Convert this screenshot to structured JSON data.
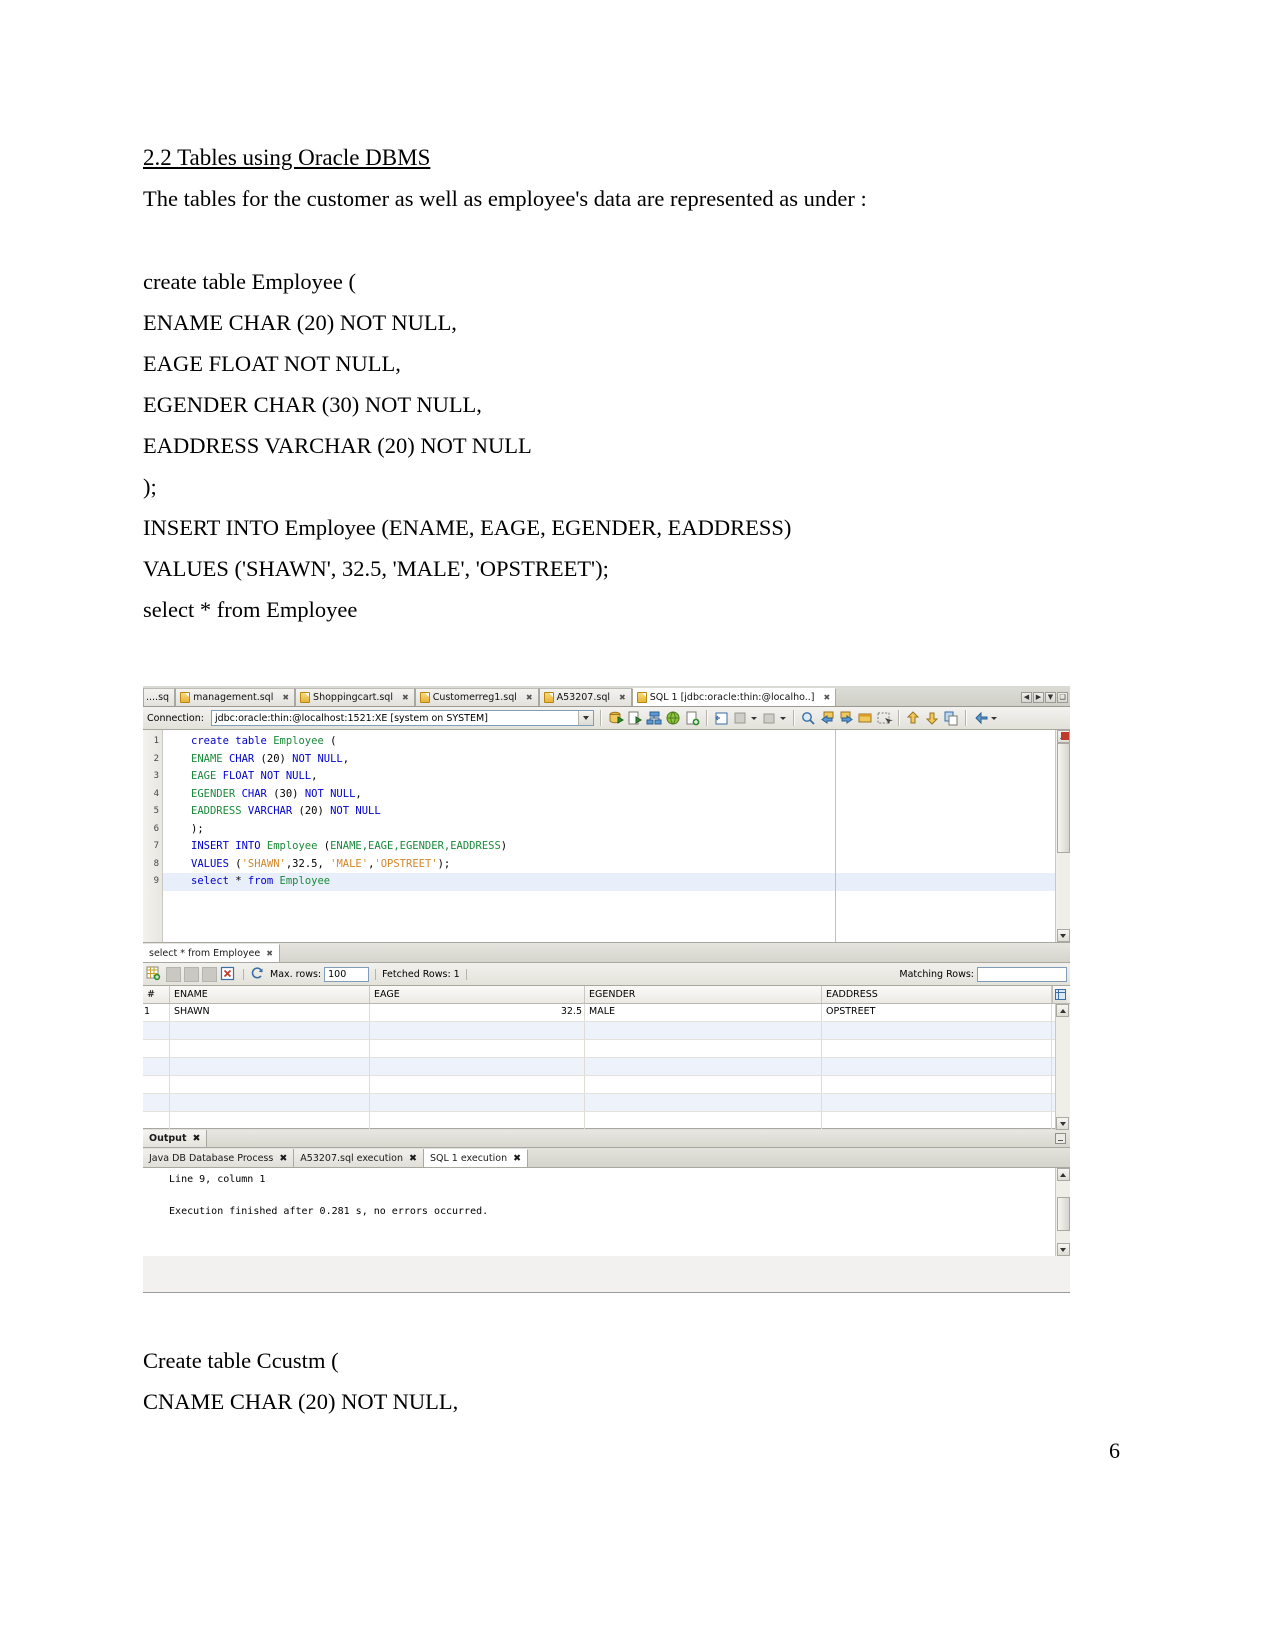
{
  "document": {
    "heading": "2.2 Tables using Oracle DBMS",
    "intro": "The tables for the customer as well as employee's data are represented as under :",
    "sql_lines": [
      "create table Employee (",
      "ENAME CHAR (20) NOT NULL,",
      "EAGE FLOAT NOT NULL,",
      "EGENDER CHAR (30) NOT NULL,",
      "EADDRESS VARCHAR (20) NOT NULL",
      ");",
      "INSERT INTO Employee (ENAME, EAGE, EGENDER, EADDRESS)",
      "VALUES ('SHAWN', 32.5, 'MALE', 'OPSTREET');",
      "select * from Employee"
    ],
    "bottom_lines": [
      "Create table Ccustm (",
      "CNAME CHAR (20) NOT NULL,"
    ],
    "page_number": "6"
  },
  "ide": {
    "tabs": [
      {
        "label": "....sq",
        "truncated": true,
        "icon": "sql-file-icon",
        "active": false,
        "closable": false
      },
      {
        "label": "management.sql",
        "icon": "sql-file-icon",
        "active": false,
        "closable": true
      },
      {
        "label": "Shoppingcart.sql",
        "icon": "sql-file-icon",
        "active": false,
        "closable": true
      },
      {
        "label": "Customerreg1.sql",
        "icon": "sql-file-icon",
        "active": false,
        "closable": true
      },
      {
        "label": "A53207.sql",
        "icon": "sql-file-icon",
        "active": false,
        "closable": true
      },
      {
        "label": "SQL 1 [jdbc:oracle:thin:@localho..]",
        "icon": "sql-file-icon",
        "active": true,
        "closable": true
      }
    ],
    "tab_close_glyph": "✖",
    "tab_nav_buttons": [
      "◀",
      "▶",
      "▼",
      "❑"
    ],
    "connection": {
      "label": "Connection:",
      "value": "jdbc:oracle:thin:@localhost:1521:XE [system on SYSTEM]",
      "dropdown_icon": "chevron-down-icon"
    },
    "toolbar_icons": [
      "run-statement-icon",
      "run-script-icon",
      "explain-plan-icon",
      "globe-icon",
      "new-worksheet-icon",
      "commit-icon",
      "rollback-icon",
      "autocommit-icon",
      "find-icon",
      "previous-icon",
      "next-icon",
      "window-icon",
      "select-region-icon",
      "up-arrow-icon",
      "down-arrow-icon",
      "copy-icon",
      "history-icon",
      "overflow-chevron-icon"
    ],
    "editor": {
      "line_numbers": [
        "1",
        "2",
        "3",
        "4",
        "5",
        "6",
        "7",
        "8",
        "9"
      ],
      "lines": [
        [
          {
            "t": "create table ",
            "c": "kw"
          },
          {
            "t": "Employee",
            "c": "ident"
          },
          {
            "t": " (",
            "c": "punc"
          }
        ],
        [
          {
            "t": "ENAME",
            "c": "ident"
          },
          {
            "t": " ",
            "c": "punc"
          },
          {
            "t": "CHAR",
            "c": "kw"
          },
          {
            "t": " (20) ",
            "c": "punc"
          },
          {
            "t": "NOT NULL",
            "c": "kw"
          },
          {
            "t": ",",
            "c": "punc"
          }
        ],
        [
          {
            "t": "EAGE",
            "c": "ident"
          },
          {
            "t": " ",
            "c": "punc"
          },
          {
            "t": "FLOAT NOT NULL",
            "c": "kw"
          },
          {
            "t": ",",
            "c": "punc"
          }
        ],
        [
          {
            "t": "EGENDER",
            "c": "ident"
          },
          {
            "t": " ",
            "c": "punc"
          },
          {
            "t": "CHAR",
            "c": "kw"
          },
          {
            "t": " (30) ",
            "c": "punc"
          },
          {
            "t": "NOT NULL",
            "c": "kw"
          },
          {
            "t": ",",
            "c": "punc"
          }
        ],
        [
          {
            "t": "EADDRESS",
            "c": "ident"
          },
          {
            "t": " ",
            "c": "punc"
          },
          {
            "t": "VARCHAR",
            "c": "kw"
          },
          {
            "t": " (20) ",
            "c": "punc"
          },
          {
            "t": "NOT NULL",
            "c": "kw"
          }
        ],
        [
          {
            "t": ");",
            "c": "punc"
          }
        ],
        [
          {
            "t": "INSERT INTO",
            "c": "kw"
          },
          {
            "t": " ",
            "c": "punc"
          },
          {
            "t": "Employee",
            "c": "ident"
          },
          {
            "t": " (",
            "c": "punc"
          },
          {
            "t": "ENAME,EAGE,EGENDER,EADDRESS",
            "c": "ident"
          },
          {
            "t": ")",
            "c": "punc"
          }
        ],
        [
          {
            "t": "VALUES",
            "c": "kw"
          },
          {
            "t": " (",
            "c": "punc"
          },
          {
            "t": "'SHAWN'",
            "c": "str"
          },
          {
            "t": ",32.5, ",
            "c": "punc"
          },
          {
            "t": "'MALE'",
            "c": "str"
          },
          {
            "t": ",",
            "c": "punc"
          },
          {
            "t": "'OPSTREET'",
            "c": "str"
          },
          {
            "t": ");",
            "c": "punc"
          }
        ],
        [
          {
            "t": "select",
            "c": "kw"
          },
          {
            "t": " * ",
            "c": "punc"
          },
          {
            "t": "from",
            "c": "kw"
          },
          {
            "t": " ",
            "c": "punc"
          },
          {
            "t": "Employee",
            "c": "ident"
          }
        ]
      ],
      "current_line_index": 8
    },
    "result_tab": {
      "label": "select * from Employee",
      "close_glyph": "✖"
    },
    "result_toolbar": {
      "buttons": [
        "grid-export-icon",
        "grid-insert-icon",
        "grid-delete-icon",
        "grid-commit-icon",
        "grid-cancel-icon"
      ],
      "refresh_icon": "refresh-icon",
      "max_rows_label": "Max. rows:",
      "max_rows_value": "100",
      "fetched_rows_label": "Fetched Rows:",
      "fetched_rows_value": "1",
      "matching_rows_label": "Matching Rows:",
      "matching_rows_value": ""
    },
    "result_grid": {
      "columns": [
        "#",
        "ENAME",
        "EAGE",
        "EGENDER",
        "EADDRESS"
      ],
      "rows": [
        [
          "1",
          "SHAWN",
          "32.5",
          "MALE",
          "OPSTREET"
        ]
      ],
      "empty_row_count": 6
    },
    "output": {
      "panel_title": "Output",
      "panel_close_glyph": "✖",
      "tabs": [
        {
          "label": "Java DB Database Process",
          "active": false
        },
        {
          "label": "A53207.sql execution",
          "active": false
        },
        {
          "label": "SQL 1 execution",
          "active": true
        }
      ],
      "tab_close_glyph": "✖",
      "lines": [
        "  Line 9, column 1",
        "",
        "  Execution finished after 0.281 s, no errors occurred."
      ]
    }
  },
  "colors": {
    "keyword": "#0000cd",
    "identifier": "#1b8a3a",
    "string": "#d2872b",
    "current_line": "#e8eefa",
    "alt_row": "#eef2fb",
    "caret_marker": "#f2aab0"
  }
}
